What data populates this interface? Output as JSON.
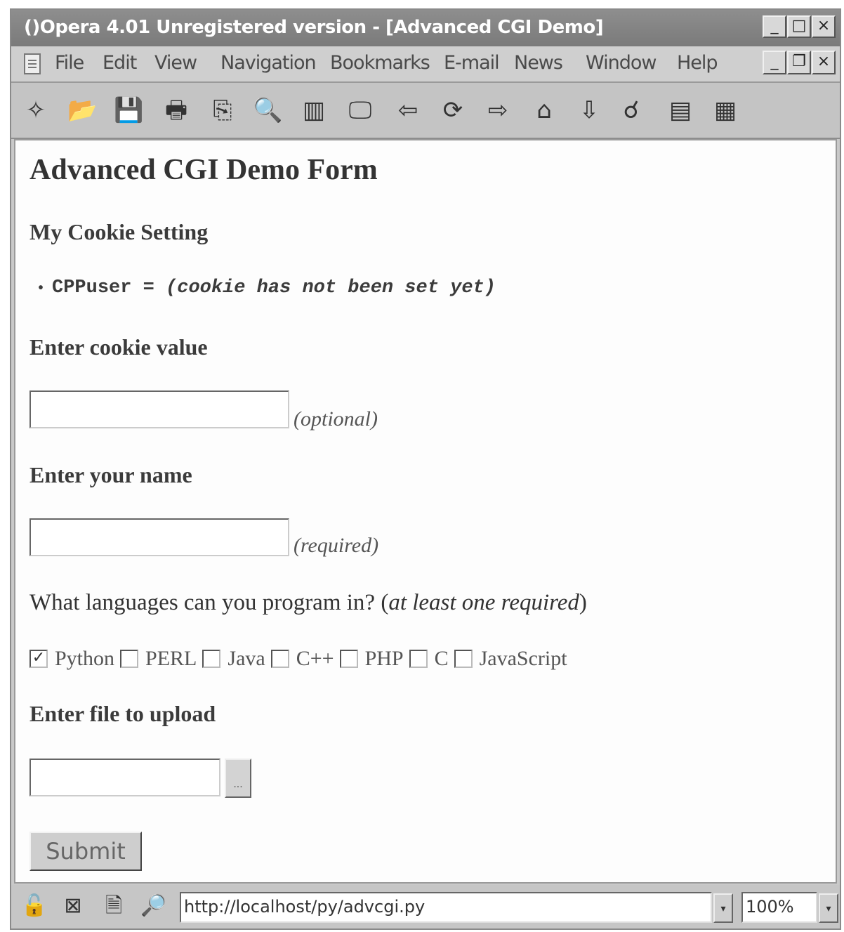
{
  "window": {
    "title": "()Opera 4.01 Unregistered version - [Advanced CGI Demo]",
    "minimize_glyph": "_",
    "maximize_glyph": "□",
    "close_glyph": "×",
    "restore_glyph": "❐"
  },
  "menu": {
    "items": [
      "File",
      "Edit",
      "View",
      "Navigation",
      "Bookmarks",
      "E-mail",
      "News",
      "Window",
      "Help"
    ]
  },
  "toolbar": {
    "icons": [
      "new-page-icon",
      "open-icon",
      "save-icon",
      "print-icon",
      "copy-icon",
      "find-icon",
      "hotlist-icon",
      "view-icon",
      "back-icon",
      "reload-icon",
      "forward-icon",
      "home-icon",
      "download-icon",
      "search-icon",
      "panels-icon",
      "page-icon"
    ],
    "glyphs": [
      "✧",
      "📂",
      "💾",
      "🖶",
      "⎘",
      "🔍",
      "▥",
      "🖵",
      "⇦",
      "⟳",
      "⇨",
      "⌂",
      "⇩",
      "☌",
      "▤",
      "▦"
    ]
  },
  "page": {
    "heading": "Advanced CGI Demo Form",
    "cookie_section_heading": "My Cookie Setting",
    "cookie_bullet": "•",
    "cookie_name": "CPPuser = ",
    "cookie_value": "(cookie has not been set yet)",
    "cookie_input_heading": "Enter cookie value",
    "cookie_input_value": "",
    "cookie_hint": "(optional)",
    "name_heading": "Enter your name",
    "name_input_value": "",
    "name_hint": "(required)",
    "languages_question": "What languages can you program in? (",
    "languages_hint": "at least one required",
    "languages_close": ")",
    "languages": [
      {
        "label": "Python",
        "checked": true,
        "mark": "✓"
      },
      {
        "label": "PERL",
        "checked": false,
        "mark": ""
      },
      {
        "label": "Java",
        "checked": false,
        "mark": ""
      },
      {
        "label": "C++",
        "checked": false,
        "mark": ""
      },
      {
        "label": "PHP",
        "checked": false,
        "mark": ""
      },
      {
        "label": "C",
        "checked": false,
        "mark": ""
      },
      {
        "label": "JavaScript",
        "checked": false,
        "mark": ""
      }
    ],
    "upload_heading": "Enter file to upload",
    "upload_value": "",
    "browse_label": "...",
    "submit_label": "Submit"
  },
  "status": {
    "icons": [
      "lock-icon",
      "stop-icon",
      "page-info-icon",
      "find-page-icon"
    ],
    "glyphs": [
      "🔓",
      "⊠",
      "🗎",
      "🔎"
    ],
    "url": "http://localhost/py/advcgi.py",
    "zoom": "100%",
    "dropdown_glyph": "▾"
  }
}
